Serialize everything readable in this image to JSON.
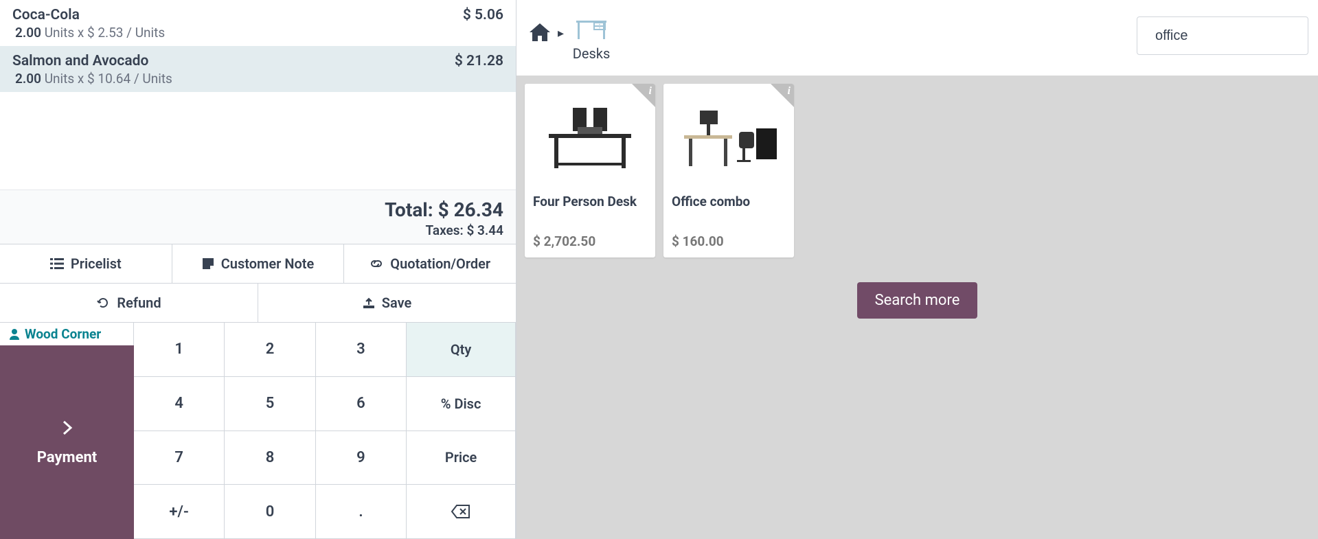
{
  "order": {
    "lines": [
      {
        "name": "Coca-Cola",
        "qty": "2.00",
        "unit": "Units",
        "unit_price": "$ 2.53",
        "line_total": "$ 5.06",
        "selected": false
      },
      {
        "name": "Salmon and Avocado",
        "qty": "2.00",
        "unit": "Units",
        "unit_price": "$ 10.64",
        "line_total": "$ 21.28",
        "selected": true
      }
    ],
    "total_label": "Total:",
    "total": "$ 26.34",
    "taxes_label": "Taxes:",
    "taxes": "$ 3.44"
  },
  "actions": {
    "pricelist": "Pricelist",
    "customer_note": "Customer Note",
    "quotation": "Quotation/Order",
    "refund": "Refund",
    "save": "Save"
  },
  "customer": {
    "name": "Wood Corner"
  },
  "payment_label": "Payment",
  "keypad": {
    "k1": "1",
    "k2": "2",
    "k3": "3",
    "k4": "4",
    "k5": "5",
    "k6": "6",
    "k7": "7",
    "k8": "8",
    "k9": "9",
    "k0": "0",
    "plusminus": "+/-",
    "dot": ".",
    "qty": "Qty",
    "disc": "% Disc",
    "price": "Price"
  },
  "breadcrumb": {
    "category": "Desks"
  },
  "search": {
    "value": "office"
  },
  "products": [
    {
      "name": "Four Person Desk",
      "price": "$ 2,702.50"
    },
    {
      "name": "Office combo",
      "price": "$ 160.00"
    }
  ],
  "search_more": "Search more"
}
